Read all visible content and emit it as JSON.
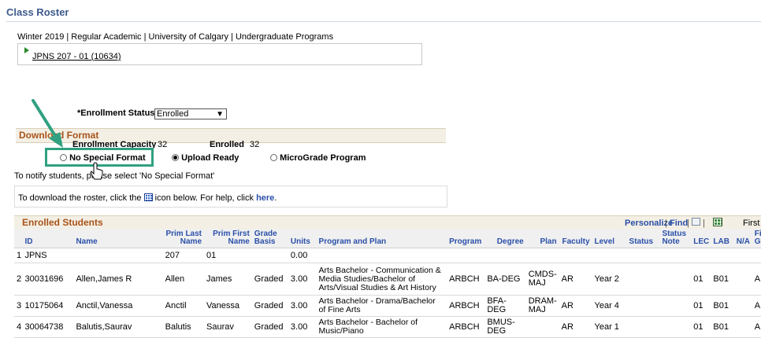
{
  "page": {
    "title": "Class Roster",
    "term_info": "Winter 2019 | Regular Academic | University of Calgary | Undergraduate Programs",
    "class_link": "JPNS 207 - 01 (10634)"
  },
  "enrollment": {
    "status_label": "*Enrollment Status",
    "status_value": "Enrolled",
    "capacity_label": "Enrollment Capacity",
    "capacity_value": "32",
    "enrolled_label": "Enrolled",
    "enrolled_value": "32"
  },
  "download": {
    "title": "Download Format",
    "options": [
      {
        "label": "No Special Format",
        "selected": false
      },
      {
        "label": "Upload Ready",
        "selected": true
      },
      {
        "label": "MicroGrade Program",
        "selected": false
      }
    ],
    "notify_text": "To notify students, please select 'No Special Format'",
    "roster_text_before": "To download the roster, click the",
    "roster_text_after": "icon below. For help, click",
    "help_link": "here",
    "period": "."
  },
  "grid": {
    "title": "Enrolled Students",
    "personalize": "Personalize",
    "find": "Find",
    "sep": "|",
    "first": "First",
    "columns": [
      "ID",
      "Name",
      "Prim Last Name",
      "Prim First Name",
      "Grade Basis",
      "Units",
      "Program and Plan",
      "Program",
      "Degree",
      "Plan",
      "Faculty",
      "Level",
      "Status",
      "Status Note",
      "LEC",
      "LAB",
      "N/A",
      "Final Grade"
    ],
    "rows": [
      [
        "1",
        "JPNS",
        "",
        "207",
        "01",
        "",
        "0.00",
        "",
        "",
        "",
        "",
        "",
        "",
        "",
        "",
        "",
        "",
        "",
        ""
      ],
      [
        "2",
        "30031696",
        "Allen,James R",
        "Allen",
        "James",
        "Graded",
        "3.00",
        "Arts Bachelor - Communication & Media Studies/Bachelor of Arts/Visual Studies & Art History",
        "ARBCH",
        "BA-DEG",
        "CMDS-MAJ",
        "AR",
        "Year 2",
        "",
        "",
        "01",
        "B01",
        "",
        "A"
      ],
      [
        "3",
        "10175064",
        "Anctil,Vanessa",
        "Anctil",
        "Vanessa",
        "Graded",
        "3.00",
        "Arts Bachelor - Drama/Bachelor of Fine Arts",
        "ARBCH",
        "BFA-DEG",
        "DRAM-MAJ",
        "AR",
        "Year 4",
        "",
        "",
        "01",
        "B01",
        "",
        "A"
      ],
      [
        "4",
        "30064738",
        "Balutis,Saurav",
        "Balutis",
        "Saurav",
        "Graded",
        "3.00",
        "Arts Bachelor - Bachelor of Music/Piano",
        "ARBCH",
        "BMUS-DEG",
        "",
        "AR",
        "Year 1",
        "",
        "",
        "01",
        "B01",
        "",
        "A"
      ]
    ]
  }
}
